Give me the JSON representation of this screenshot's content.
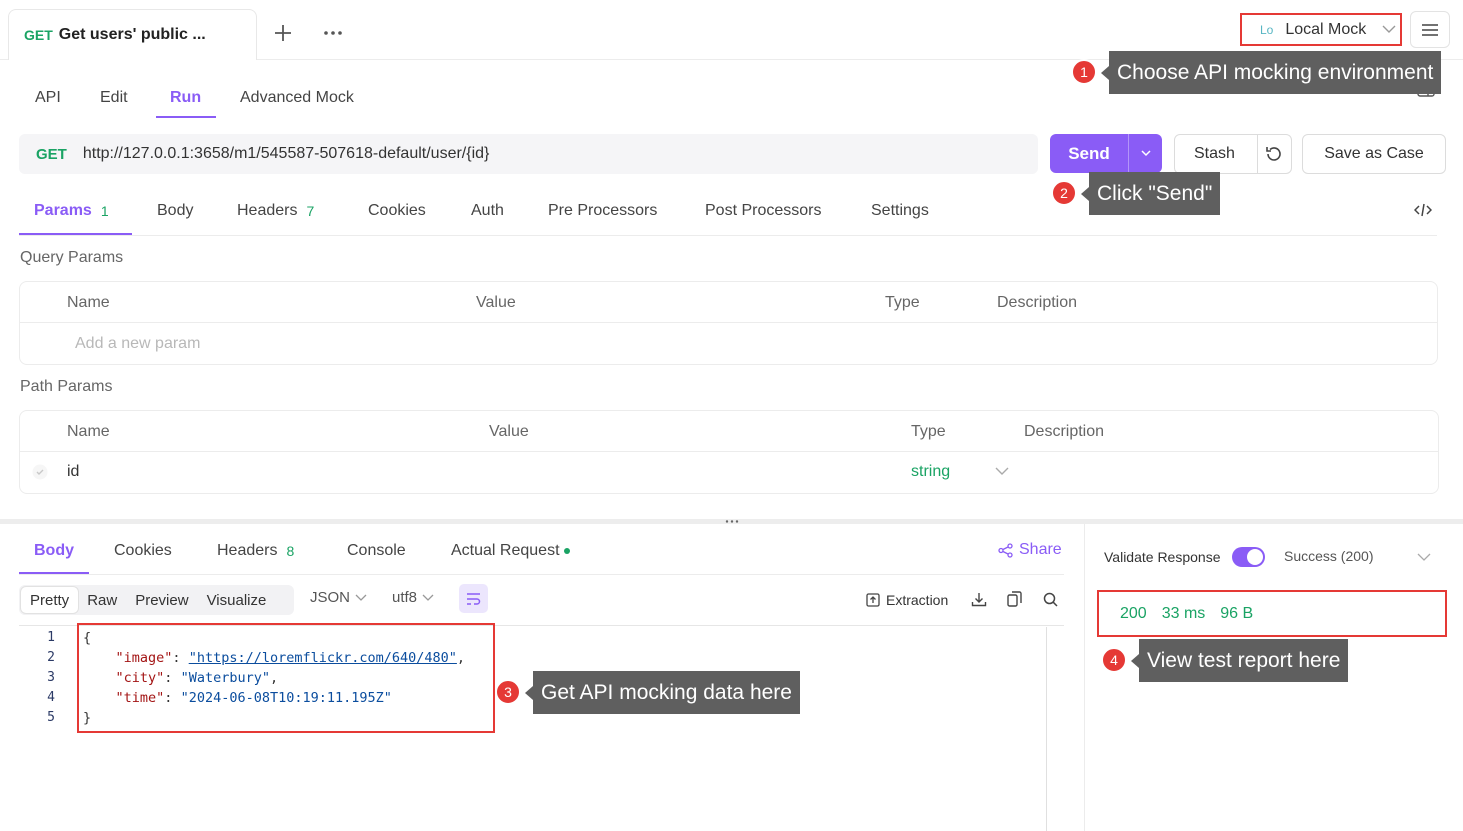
{
  "doc_tab": {
    "method": "GET",
    "title": "Get users' public ..."
  },
  "header": {
    "env_abbr": "Lo",
    "env_name": "Local Mock"
  },
  "subtabs": [
    "API",
    "Edit",
    "Run",
    "Advanced Mock"
  ],
  "request": {
    "method": "GET",
    "url": "http://127.0.0.1:3658/m1/545587-507618-default/user/{id}",
    "send_label": "Send",
    "stash_label": "Stash",
    "save_case_label": "Save as Case"
  },
  "request_tabs": [
    {
      "label": "Params",
      "count": "1"
    },
    {
      "label": "Body"
    },
    {
      "label": "Headers",
      "count": "7"
    },
    {
      "label": "Cookies"
    },
    {
      "label": "Auth"
    },
    {
      "label": "Pre Processors"
    },
    {
      "label": "Post Processors"
    },
    {
      "label": "Settings"
    }
  ],
  "query_params": {
    "title": "Query Params",
    "columns": [
      "Name",
      "Value",
      "Type",
      "Description"
    ],
    "placeholder": "Add a new param"
  },
  "path_params": {
    "title": "Path Params",
    "columns": [
      "Name",
      "Value",
      "Type",
      "Description"
    ],
    "rows": [
      {
        "name": "id",
        "type": "string"
      }
    ]
  },
  "response_tabs": [
    {
      "label": "Body"
    },
    {
      "label": "Cookies"
    },
    {
      "label": "Headers",
      "count": "8"
    },
    {
      "label": "Console"
    },
    {
      "label": "Actual Request"
    }
  ],
  "share_label": "Share",
  "view_modes": [
    "Pretty",
    "Raw",
    "Preview",
    "Visualize"
  ],
  "format": "JSON",
  "encoding": "utf8",
  "extraction_label": "Extraction",
  "code": {
    "line_numbers": [
      "1",
      "2",
      "3",
      "4",
      "5"
    ],
    "open": "{",
    "close": "}",
    "fields": [
      {
        "key": "\"image\"",
        "value": "\"https://loremflickr.com/640/480\"",
        "is_link": true,
        "trail": ","
      },
      {
        "key": "\"city\"",
        "value": "\"Waterbury\"",
        "trail": ","
      },
      {
        "key": "\"time\"",
        "value": "\"2024-06-08T10:19:11.195Z\"",
        "trail": ""
      }
    ]
  },
  "validate": {
    "label": "Validate Response",
    "enabled": true,
    "status": "Success (200)"
  },
  "stats": {
    "status_code": "200",
    "time": "33 ms",
    "size": "96 B"
  },
  "annotations": [
    {
      "num": "1",
      "text": "Choose API mocking environment"
    },
    {
      "num": "2",
      "text": "Click \"Send\""
    },
    {
      "num": "3",
      "text": "Get API mocking data here"
    },
    {
      "num": "4",
      "text": "View test report here"
    }
  ],
  "colors": {
    "accent": "#8a5cf6",
    "method_get": "#1aa364",
    "annotation_red": "#e53935",
    "tooltip_bg": "#5f5f5f"
  }
}
